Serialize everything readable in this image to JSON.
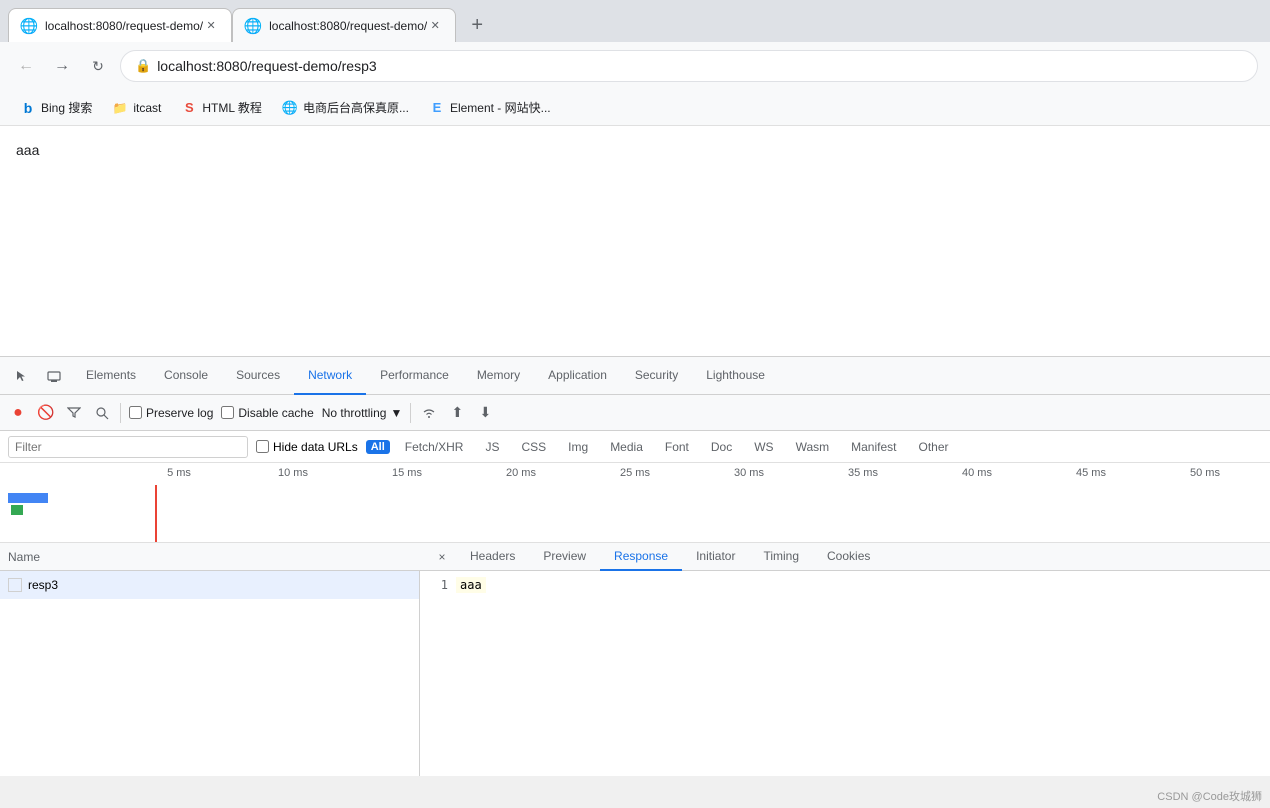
{
  "browser": {
    "tabs": [
      {
        "id": "tab1",
        "favicon": "🌐",
        "title": "localhost:8080/request-demo/",
        "active": false
      },
      {
        "id": "tab2",
        "favicon": "🌐",
        "title": "localhost:8080/request-demo/",
        "active": true
      }
    ],
    "new_tab_label": "+",
    "nav": {
      "back": "←",
      "forward": "→",
      "reload": "C",
      "url": "localhost:8080/request-demo/resp3",
      "lock_icon": "🔒"
    },
    "bookmarks": [
      {
        "icon": "b",
        "label": "Bing 搜索",
        "color": "#0078d4"
      },
      {
        "icon": "📁",
        "label": "itcast",
        "color": "#f0a500"
      },
      {
        "icon": "S",
        "label": "HTML 教程",
        "color": "#e84c3d"
      },
      {
        "icon": "🌐",
        "label": "电商后台高保真原...",
        "color": "#1a73e8"
      },
      {
        "icon": "E",
        "label": "Element - 网站快...",
        "color": "#409eff"
      }
    ]
  },
  "page": {
    "content": "aaa"
  },
  "devtools": {
    "icon_buttons": [
      "⬜",
      "📄"
    ],
    "tabs": [
      {
        "id": "elements",
        "label": "Elements",
        "active": false
      },
      {
        "id": "console",
        "label": "Console",
        "active": false
      },
      {
        "id": "sources",
        "label": "Sources",
        "active": false
      },
      {
        "id": "network",
        "label": "Network",
        "active": true
      },
      {
        "id": "performance",
        "label": "Performance",
        "active": false
      },
      {
        "id": "memory",
        "label": "Memory",
        "active": false
      },
      {
        "id": "application",
        "label": "Application",
        "active": false
      },
      {
        "id": "security",
        "label": "Security",
        "active": false
      },
      {
        "id": "lighthouse",
        "label": "Lighthouse",
        "active": false
      }
    ],
    "toolbar": {
      "record_label": "●",
      "clear_label": "🚫",
      "filter_label": "▼",
      "search_label": "🔍",
      "preserve_log": "Preserve log",
      "disable_cache": "Disable cache",
      "throttling": "No throttling",
      "throttle_arrow": "▼",
      "wifi_icon": "wifi",
      "upload_icon": "⬆",
      "download_icon": "⬇"
    },
    "filter": {
      "placeholder": "Filter",
      "hide_data_urls": "Hide data URLs",
      "all_badge": "All",
      "type_filters": [
        "Fetch/XHR",
        "JS",
        "CSS",
        "Img",
        "Media",
        "Font",
        "Doc",
        "WS",
        "Wasm",
        "Manifest",
        "Other"
      ]
    },
    "timeline": {
      "rulers": [
        "5 ms",
        "10 ms",
        "15 ms",
        "20 ms",
        "25 ms",
        "30 ms",
        "35 ms",
        "40 ms",
        "45 ms",
        "50 ms"
      ]
    },
    "request_panel": {
      "name_col": "Name",
      "close_col": "×",
      "detail_tabs": [
        {
          "id": "headers",
          "label": "Headers",
          "active": false
        },
        {
          "id": "preview",
          "label": "Preview",
          "active": false
        },
        {
          "id": "response",
          "label": "Response",
          "active": true
        },
        {
          "id": "initiator",
          "label": "Initiator",
          "active": false
        },
        {
          "id": "timing",
          "label": "Timing",
          "active": false
        },
        {
          "id": "cookies",
          "label": "Cookies",
          "active": false
        }
      ],
      "requests": [
        {
          "name": "resp3",
          "line_num": "1",
          "content": "aaa"
        }
      ]
    }
  },
  "attribution": "CSDN @Code玫城狮"
}
